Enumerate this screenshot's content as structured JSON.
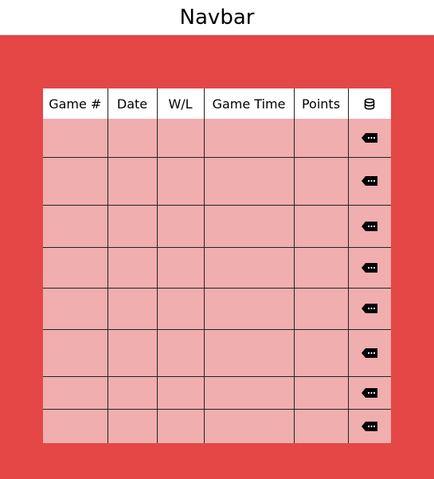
{
  "navbar": {
    "title": "Navbar"
  },
  "table": {
    "headers": [
      "Game #",
      "Date",
      "W/L",
      "Game Time",
      "Points"
    ],
    "action_header_icon": "database-icon",
    "row_action_icon": "tag-more-icon",
    "rows": [
      [
        "",
        "",
        "",
        "",
        ""
      ],
      [
        "",
        "",
        "",
        "",
        ""
      ],
      [
        "",
        "",
        "",
        "",
        ""
      ],
      [
        "",
        "",
        "",
        "",
        ""
      ],
      [
        "",
        "",
        "",
        "",
        ""
      ],
      [
        "",
        "",
        "",
        "",
        ""
      ],
      [
        "",
        "",
        "",
        "",
        ""
      ],
      [
        "",
        "",
        "",
        "",
        ""
      ]
    ]
  },
  "colors": {
    "panel_background": "#e54646",
    "cell_background": "#f0aeae",
    "header_background": "#ffffff",
    "grid_line": "#222222"
  }
}
